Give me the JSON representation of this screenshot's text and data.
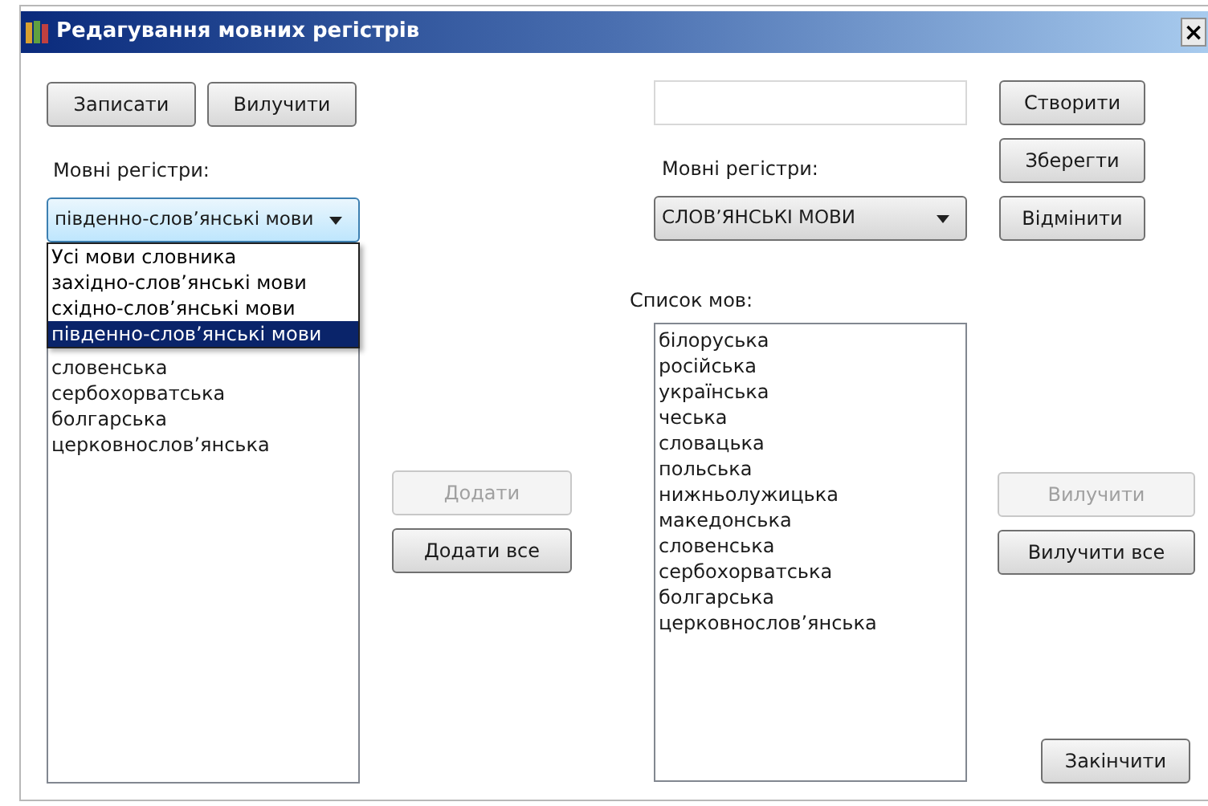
{
  "window": {
    "title": "Редагування мовних регістрів",
    "close": "×"
  },
  "left": {
    "buttons": [
      {
        "label": "Записати",
        "disabled": false
      },
      {
        "label": "Вилучити",
        "disabled": false
      }
    ],
    "label": "Мовні регістри:",
    "combo": {
      "value": "південно-слов’янські мови",
      "focused": true,
      "expanded": true,
      "options": [
        {
          "label": "Усі мови словника",
          "selected": false
        },
        {
          "label": "західно-слов’янські мови",
          "selected": false
        },
        {
          "label": "східно-слов’янські мови",
          "selected": false
        },
        {
          "label": "південно-слов’янські мови",
          "selected": true
        }
      ]
    },
    "list": [
      "словенська",
      "сербохорватська",
      "болгарська",
      "церковнослов’янська"
    ]
  },
  "middle": {
    "buttons": [
      {
        "label": "Додати",
        "disabled": true
      },
      {
        "label": "Додати все",
        "disabled": false
      }
    ]
  },
  "right": {
    "label": "Мовні регістри:",
    "combo": {
      "value": "СЛОВ’ЯНСЬКІ МОВИ",
      "focused": false,
      "expanded": false
    },
    "list_label": "Список мов:",
    "list": [
      "білоруська",
      "російська",
      "українська",
      "чеська",
      "словацька",
      "польська",
      "нижньолужицька",
      "македонська",
      "словенська",
      "сербохорватська",
      "болгарська",
      "церковнослов’янська"
    ]
  },
  "side_buttons": [
    {
      "label": "Створити",
      "disabled": false
    },
    {
      "label": "Зберегти",
      "disabled": false
    },
    {
      "label": "Відмінити",
      "disabled": false
    }
  ],
  "remove_buttons": [
    {
      "label": "Вилучити",
      "disabled": true
    },
    {
      "label": "Вилучити все",
      "disabled": false
    }
  ],
  "finish_button": {
    "label": "Закінчити",
    "disabled": false
  }
}
